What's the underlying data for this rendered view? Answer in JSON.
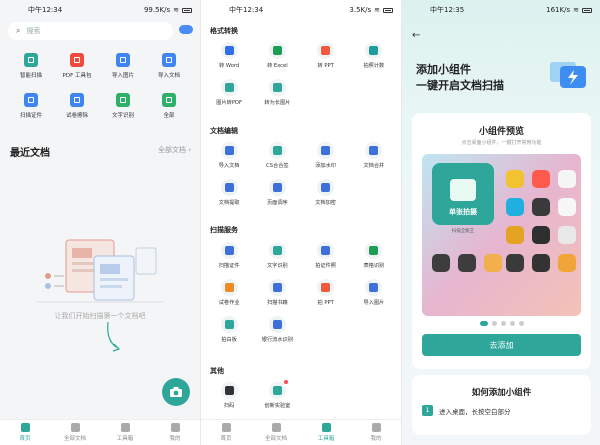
{
  "p1": {
    "status": {
      "time": "中午12:34",
      "net": "99.5K/s"
    },
    "search_placeholder": "搜索",
    "tools": [
      {
        "label": "智能扫描",
        "icon": "scan-icon",
        "color": "#2ea79a"
      },
      {
        "label": "PDF 工具包",
        "icon": "pdf-icon",
        "color": "#f04c3e"
      },
      {
        "label": "导入图片",
        "icon": "image-icon",
        "color": "#3f86f0"
      },
      {
        "label": "导入文档",
        "icon": "document-icon",
        "color": "#3f86f0"
      },
      {
        "label": "扫描证件",
        "icon": "id-card-icon",
        "color": "#3f86f0"
      },
      {
        "label": "试卷擦除",
        "icon": "eraser-icon",
        "color": "#3f86f0"
      },
      {
        "label": "文字识别",
        "icon": "text-recognize-icon",
        "color": "#2eb06a"
      },
      {
        "label": "全部",
        "icon": "all-apps-icon",
        "color": "#2eb06a"
      }
    ],
    "recent_title": "最近文档",
    "all_docs_link": "全部文档",
    "empty_text": "让我们开始扫描第一个文档吧",
    "tabs": [
      {
        "label": "首页",
        "active": true
      },
      {
        "label": "全部文档",
        "active": false
      },
      {
        "label": "工具箱",
        "active": false
      },
      {
        "label": "我的",
        "active": false
      }
    ]
  },
  "p2": {
    "status": {
      "time": "中午12:34",
      "net": "3.5K/s"
    },
    "sections": [
      {
        "title": "格式转换",
        "items": [
          {
            "label": "转 Word",
            "icon": "word-icon",
            "color": "#2f6ee8"
          },
          {
            "label": "转 Excel",
            "icon": "excel-icon",
            "color": "#1f9d55"
          },
          {
            "label": "转 PPT",
            "icon": "ppt-icon",
            "color": "#ef5a3c"
          },
          {
            "label": "拍照计数",
            "icon": "count-icon",
            "color": "#1f9d9d"
          },
          {
            "label": "图片转PDF",
            "icon": "image-pdf-icon",
            "color": "#2ea79a"
          },
          {
            "label": "转为长图片",
            "icon": "long-image-icon",
            "color": "#2ea79a"
          }
        ]
      },
      {
        "title": "文档编辑",
        "items": [
          {
            "label": "导入文档",
            "icon": "import-doc-icon",
            "color": "#3f6fd8"
          },
          {
            "label": "CS合合签",
            "icon": "sign-icon",
            "color": "#2ea79a"
          },
          {
            "label": "添加水印",
            "icon": "watermark-icon",
            "color": "#3f6fd8"
          },
          {
            "label": "文档合并",
            "icon": "merge-icon",
            "color": "#3f6fd8"
          },
          {
            "label": "文档提取",
            "icon": "extract-icon",
            "color": "#3f6fd8"
          },
          {
            "label": "页面调序",
            "icon": "reorder-icon",
            "color": "#3f6fd8"
          },
          {
            "label": "文档加密",
            "icon": "lock-icon",
            "color": "#3f6fd8"
          }
        ]
      },
      {
        "title": "扫描服务",
        "items": [
          {
            "label": "扫描证件",
            "icon": "id-scan-icon",
            "color": "#3f6fd8"
          },
          {
            "label": "文字识别",
            "icon": "ocr-icon",
            "color": "#2ea79a"
          },
          {
            "label": "拍证件照",
            "icon": "photo-id-icon",
            "color": "#3f6fd8"
          },
          {
            "label": "表格识别",
            "icon": "table-icon",
            "color": "#1f9d55"
          },
          {
            "label": "试卷作业",
            "icon": "exam-icon",
            "color": "#f08a24"
          },
          {
            "label": "扫描书籍",
            "icon": "book-icon",
            "color": "#3f6fd8"
          },
          {
            "label": "拍 PPT",
            "icon": "ppt-photo-icon",
            "color": "#ef5a3c"
          },
          {
            "label": "导入图片",
            "icon": "import-image-icon",
            "color": "#3f6fd8"
          },
          {
            "label": "拍白板",
            "icon": "whiteboard-icon",
            "color": "#2ea79a"
          },
          {
            "label": "银行流水识别",
            "icon": "bank-icon",
            "color": "#3f6fd8"
          }
        ]
      },
      {
        "title": "其他",
        "items": [
          {
            "label": "扫码",
            "icon": "qr-scan-icon",
            "color": "#333333"
          },
          {
            "label": "创新实验室",
            "icon": "lab-icon",
            "color": "#2ea79a"
          }
        ]
      }
    ],
    "tabs": [
      {
        "label": "首页",
        "active": false
      },
      {
        "label": "全部文档",
        "active": false
      },
      {
        "label": "工具箱",
        "active": true
      },
      {
        "label": "我的",
        "active": false
      }
    ]
  },
  "p3": {
    "status": {
      "time": "中午12:35",
      "net": "161K/s"
    },
    "heading_line1": "添加小组件",
    "heading_line2": "一键开启文档扫描",
    "preview_title": "小组件预览",
    "preview_sub": "点击桌面小组件，一键打开常用功能",
    "widget_label": "单张拍摄",
    "widget_name": "扫描全能王",
    "add_button": "去添加",
    "howto_title": "如何添加小组件",
    "step1_num": "1",
    "step1_text": "进入桌面，长按空白部分"
  }
}
